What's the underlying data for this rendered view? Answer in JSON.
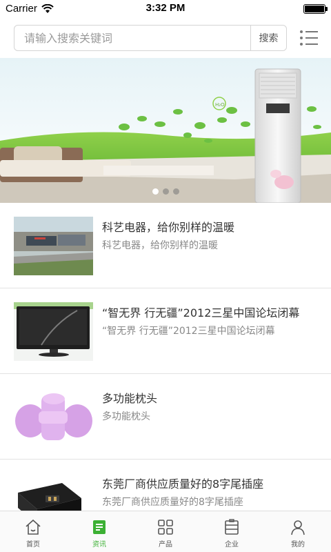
{
  "status_bar": {
    "carrier": "Carrier",
    "time": "3:32 PM"
  },
  "search": {
    "placeholder": "请输入搜索关键词",
    "button_label": "搜索"
  },
  "banner": {
    "badge_text": "H₂O",
    "slide_count": 3,
    "active_slide": 1
  },
  "news": [
    {
      "title": "科艺电器，给你别样的温暖",
      "summary": "科艺电器，给你别样的温暖",
      "image": "factory-aerial"
    },
    {
      "title": "“智无界 行无疆”2012三星中国论坛闭幕",
      "summary": "“智无界 行无疆”2012三星中国论坛闭幕",
      "image": "monitor"
    },
    {
      "title": "多功能枕头",
      "summary": "多功能枕头",
      "image": "purple-pillow"
    },
    {
      "title": "东莞厂商供应质量好的8字尾插座",
      "summary": "东莞厂商供应质量好的8字尾插座",
      "image": "power-socket"
    }
  ],
  "tabs": [
    {
      "label": "首页",
      "icon": "home-icon",
      "active": false
    },
    {
      "label": "资讯",
      "icon": "news-icon",
      "active": true
    },
    {
      "label": "产品",
      "icon": "grid-icon",
      "active": false
    },
    {
      "label": "企业",
      "icon": "building-icon",
      "active": false
    },
    {
      "label": "我的",
      "icon": "user-icon",
      "active": false
    }
  ],
  "colors": {
    "accent": "#3cb034",
    "divider": "#e2e2e2",
    "title": "#333333",
    "summary": "#888888"
  }
}
